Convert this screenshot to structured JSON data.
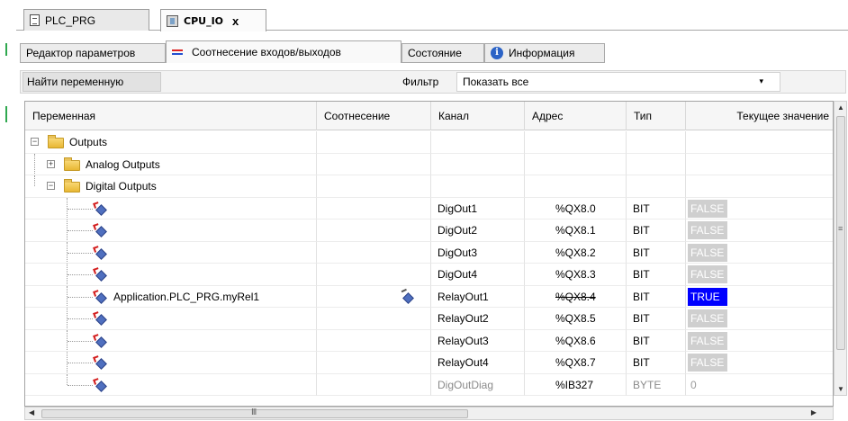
{
  "editor_tabs": [
    {
      "label": "PLC_PRG",
      "icon": "document-icon"
    },
    {
      "label": "CPU_IO",
      "icon": "device-icon",
      "close": "x"
    }
  ],
  "sub_tabs": [
    {
      "label": "Редактор параметров"
    },
    {
      "label": "Соотнесение входов/выходов",
      "icon": "io-mapping-icon"
    },
    {
      "label": "Состояние"
    },
    {
      "label": "Информация",
      "icon": "info-icon",
      "icon_glyph": "i"
    }
  ],
  "toolbar": {
    "find_label": "Найти переменную",
    "filter_label": "Фильтр",
    "filter_value": "Показать все",
    "filter_arrow": "▾"
  },
  "table": {
    "headers": [
      "Переменная",
      "Соотнесение",
      "Канал",
      "Адрес",
      "Тип",
      "Текущее значение"
    ],
    "folders": {
      "outputs": {
        "label": "Outputs",
        "expander": "−"
      },
      "analog": {
        "label": "Analog Outputs",
        "expander": "+"
      },
      "digital": {
        "label": "Digital Outputs",
        "expander": "−"
      }
    },
    "rows": [
      {
        "variable": "",
        "channel": "DigOut1",
        "address": "%QX8.0",
        "type": "BIT",
        "value": "FALSE",
        "state": "false"
      },
      {
        "variable": "",
        "channel": "DigOut2",
        "address": "%QX8.1",
        "type": "BIT",
        "value": "FALSE",
        "state": "false"
      },
      {
        "variable": "",
        "channel": "DigOut3",
        "address": "%QX8.2",
        "type": "BIT",
        "value": "FALSE",
        "state": "false"
      },
      {
        "variable": "",
        "channel": "DigOut4",
        "address": "%QX8.3",
        "type": "BIT",
        "value": "FALSE",
        "state": "false"
      },
      {
        "variable": "Application.PLC_PRG.myRel1",
        "channel": "RelayOut1",
        "address": "%QX8.4",
        "type": "BIT",
        "value": "TRUE",
        "state": "true",
        "mapped": true,
        "struck": true
      },
      {
        "variable": "",
        "channel": "RelayOut2",
        "address": "%QX8.5",
        "type": "BIT",
        "value": "FALSE",
        "state": "false"
      },
      {
        "variable": "",
        "channel": "RelayOut3",
        "address": "%QX8.6",
        "type": "BIT",
        "value": "FALSE",
        "state": "false"
      },
      {
        "variable": "",
        "channel": "RelayOut4",
        "address": "%QX8.7",
        "type": "BIT",
        "value": "FALSE",
        "state": "false"
      },
      {
        "variable": "",
        "channel": "DigOutDiag",
        "address": "%IB327",
        "type": "BYTE",
        "value": "0",
        "state": "zero",
        "input": true
      }
    ]
  },
  "scrollbars": {
    "h_grip": "III",
    "v_grip": "≡",
    "up": "▲",
    "down": "▼",
    "left": "◀",
    "right": "▶"
  },
  "colors": {
    "true_bg": "#0000ff",
    "false_bg": "#cfcfcf",
    "marker_green": "#2fa84f"
  }
}
